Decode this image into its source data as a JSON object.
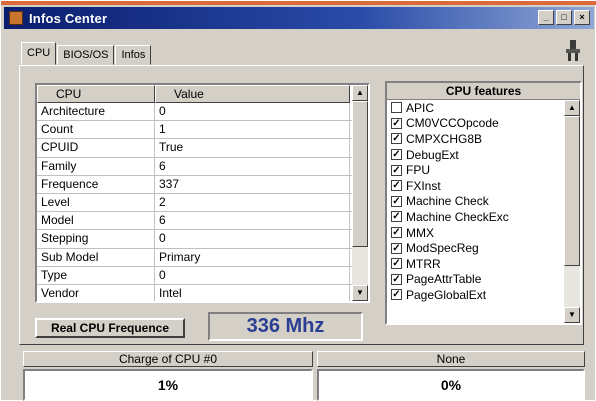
{
  "window": {
    "title": "Infos Center",
    "icon": "app-icon",
    "title_buttons": [
      "minimize",
      "maximize",
      "close"
    ],
    "title_buttons_glyphs": [
      "_",
      "□",
      "×"
    ]
  },
  "tabs": [
    {
      "label": "CPU",
      "active": true
    },
    {
      "label": "BIOS/OS",
      "active": false
    },
    {
      "label": "Infos",
      "active": false
    }
  ],
  "cpu_table": {
    "headers": [
      "CPU",
      "Value"
    ],
    "rows": [
      {
        "name": "Architecture",
        "value": "0"
      },
      {
        "name": "Count",
        "value": "1"
      },
      {
        "name": "CPUID",
        "value": "True"
      },
      {
        "name": "Family",
        "value": "6"
      },
      {
        "name": "Frequence",
        "value": "337"
      },
      {
        "name": "Level",
        "value": "2"
      },
      {
        "name": "Model",
        "value": "6"
      },
      {
        "name": "Stepping",
        "value": "0"
      },
      {
        "name": "Sub Model",
        "value": "Primary"
      },
      {
        "name": "Type",
        "value": "0"
      },
      {
        "name": "Vendor",
        "value": "Intel"
      }
    ]
  },
  "features": {
    "title": "CPU features",
    "items": [
      {
        "label": "APIC",
        "checked": false
      },
      {
        "label": "CM0VCCOpcode",
        "checked": true
      },
      {
        "label": "CMPXCHG8B",
        "checked": true
      },
      {
        "label": "DebugExt",
        "checked": true
      },
      {
        "label": "FPU",
        "checked": true
      },
      {
        "label": "FXInst",
        "checked": true
      },
      {
        "label": "Machine Check",
        "checked": true
      },
      {
        "label": "Machine CheckExc",
        "checked": true
      },
      {
        "label": "MMX",
        "checked": true
      },
      {
        "label": "ModSpecReg",
        "checked": true
      },
      {
        "label": "MTRR",
        "checked": true
      },
      {
        "label": "PageAttrTable",
        "checked": true
      },
      {
        "label": "PageGlobalExt",
        "checked": true
      }
    ]
  },
  "real_cpu_button": "Real CPU Frequence",
  "frequency_display": "336 Mhz",
  "status": {
    "left_label": "Charge of CPU #0",
    "left_value": "1%",
    "right_label": "None",
    "right_value": "0%"
  },
  "colors": {
    "title_gradient_start": "#0a1d6e",
    "frequency_text": "#2a3f94",
    "top_strip": "#d96a3a"
  }
}
